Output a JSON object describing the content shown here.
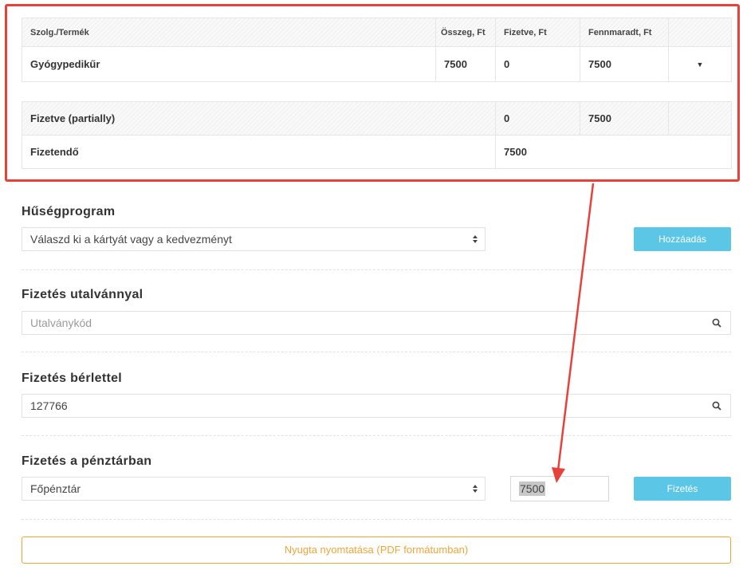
{
  "items_table": {
    "headers": [
      "Szolg./Termék",
      "Összeg, Ft",
      "Fizetve, Ft",
      "Fennmaradt, Ft"
    ],
    "rows": [
      {
        "name": "Gyógypedikűr",
        "amount": "7500",
        "paid": "0",
        "remaining": "7500"
      }
    ]
  },
  "summary": {
    "paid_label": "Fizetve (partially)",
    "paid_value": "0",
    "paid_remaining": "7500",
    "due_label": "Fizetendő",
    "due_value": "7500"
  },
  "loyalty": {
    "title": "Hűségprogram",
    "select_value": "Válaszd ki a kártyát vagy a kedvezményt",
    "add_button": "Hozzáadás"
  },
  "voucher": {
    "title": "Fizetés utalvánnyal",
    "placeholder": "Utalványkód"
  },
  "pass": {
    "title": "Fizetés bérlettel",
    "value": "127766"
  },
  "cashier": {
    "title": "Fizetés a pénztárban",
    "select_value": "Főpénztár",
    "amount": "7500",
    "pay_button": "Fizetés"
  },
  "print_button": "Nyugta nyomtatása (PDF formátumban)",
  "colors": {
    "highlight": "#e8413a",
    "primary_button": "#5bc6e6",
    "print_button": "#f0a53a"
  },
  "icons": {
    "search": "magnifier",
    "select": "up-down-caret",
    "row_menu": "caret-down"
  }
}
